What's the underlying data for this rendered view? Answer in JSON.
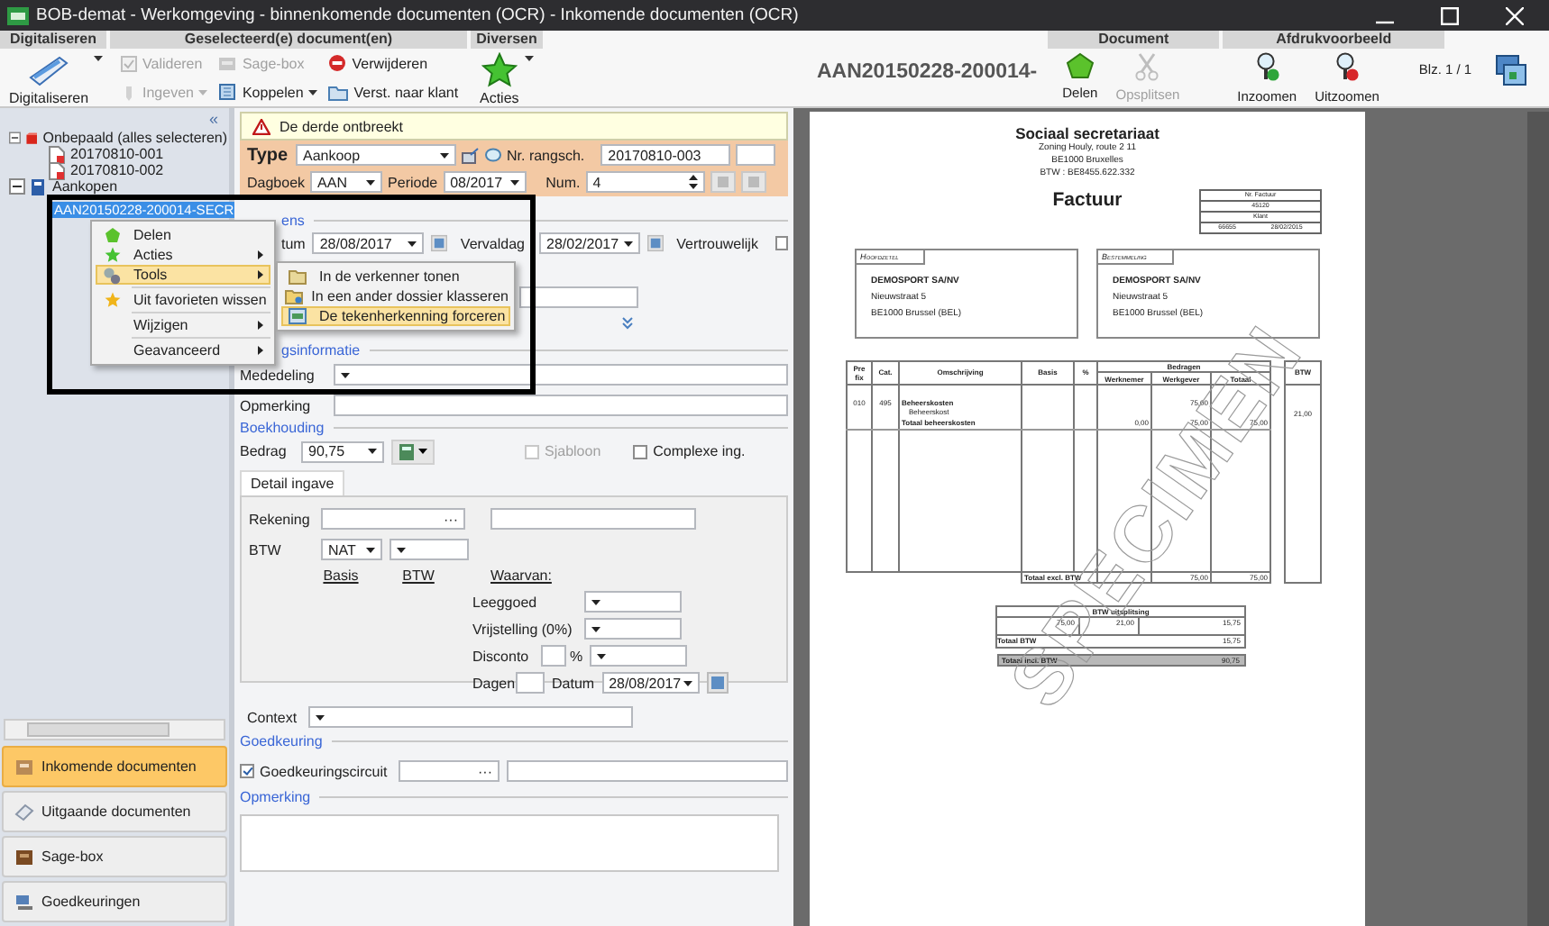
{
  "window": {
    "title": "BOB-demat - Werkomgeving - binnenkomende documenten (OCR) - Inkomende documenten (OCR)"
  },
  "ribbon": {
    "groups": [
      "Digitaliseren",
      "Geselecteerd(e) document(en)",
      "Diversen"
    ],
    "scan": {
      "label": "Digitaliseren",
      "disabled": false
    },
    "valideren": {
      "label": "Valideren",
      "disabled": true
    },
    "ingeven": {
      "label": "Ingeven",
      "disabled": true
    },
    "sagebox": {
      "label": "Sage-box",
      "disabled": true
    },
    "koppelen": {
      "label": "Koppelen",
      "disabled": false
    },
    "verwijderen": {
      "label": "Verwijderen",
      "disabled": false
    },
    "verst": {
      "label": "Verst. naar klant",
      "disabled": false
    },
    "acties": {
      "label": "Acties",
      "disabled": false
    }
  },
  "viewer_ribbon": {
    "doc_title": "AAN20150228-200014-",
    "groups": [
      "Document",
      "Afdrukvoorbeeld"
    ],
    "delen": {
      "label": "Delen",
      "disabled": false
    },
    "opsplitsen": {
      "label": "Opsplitsen",
      "disabled": true
    },
    "inzoomen": {
      "label": "Inzoomen",
      "disabled": false
    },
    "uitzoomen": {
      "label": "Uitzoomen",
      "disabled": false
    },
    "page": "Blz. 1 / 1"
  },
  "navigation": {
    "collapse": "«",
    "tree": [
      {
        "label": "Onbepaald (alles selecteren)",
        "expanded": true,
        "selected": false,
        "children": [
          {
            "label": "20170810-001",
            "selected": false
          },
          {
            "label": "20170810-002",
            "selected": false
          }
        ]
      },
      {
        "label": "Aankopen",
        "expanded": true,
        "selected": false,
        "children": [
          {
            "label": "AAN20150228-200014-SECR",
            "selected": true
          }
        ]
      }
    ],
    "modules": [
      {
        "label": "Inkomende documenten",
        "selected": true
      },
      {
        "label": "Uitgaande documenten",
        "selected": false
      },
      {
        "label": "Sage-box",
        "selected": false
      },
      {
        "label": "Goedkeuringen",
        "selected": false
      }
    ]
  },
  "context_menu": {
    "items": [
      {
        "kind": "item",
        "label": "Delen",
        "submenu": false,
        "selected": false
      },
      {
        "kind": "item",
        "label": "Acties",
        "submenu": true,
        "selected": false
      },
      {
        "kind": "item",
        "label": "Tools",
        "submenu": true,
        "selected": true,
        "children": [
          {
            "label": "In de verkenner tonen",
            "selected": false
          },
          {
            "label": "In een ander dossier klasseren",
            "selected": false
          },
          {
            "label": "De tekenherkenning forceren",
            "selected": true
          }
        ]
      },
      {
        "kind": "separator"
      },
      {
        "kind": "item",
        "label": "Uit favorieten wissen",
        "submenu": false,
        "selected": false
      },
      {
        "kind": "separator"
      },
      {
        "kind": "item",
        "label": "Wijzigen",
        "submenu": true,
        "selected": false
      },
      {
        "kind": "separator"
      },
      {
        "kind": "item",
        "label": "Geavanceerd",
        "submenu": true,
        "selected": false
      }
    ]
  },
  "form": {
    "alert": "De derde ontbreekt",
    "type": {
      "label": "Type",
      "value": "Aankoop"
    },
    "rangsch": {
      "label": "Nr. rangsch.",
      "value": "20170810-003"
    },
    "dagboek": {
      "label": "Dagboek",
      "value": "AAN"
    },
    "periode": {
      "label": "Periode",
      "value": "08/2017"
    },
    "num": {
      "label": "Num.",
      "value": "4"
    },
    "gegevens_heading": "ens",
    "datum": {
      "label": "tum",
      "value": "28/08/2017"
    },
    "vervaldag": {
      "label": "Vervaldag",
      "value": "28/02/2017"
    },
    "vertrouwelijk": {
      "label": "Vertrouwelijk",
      "checked": false
    },
    "betaling_heading": "gsinformatie",
    "mededeling": {
      "label": "Mededeling"
    },
    "opmerking": {
      "label": "Opmerking"
    },
    "boekhouding_heading": "Boekhouding",
    "bedrag": {
      "label": "Bedrag",
      "value": "90,75"
    },
    "sjabloon": {
      "label": "Sjabloon",
      "checked": false,
      "disabled": true
    },
    "complexe": {
      "label": "Complexe ing.",
      "checked": false,
      "disabled": false
    },
    "detail_tab": {
      "label": "Detail ingave",
      "selected": true
    },
    "rekening": {
      "label": "Rekening",
      "button": "···"
    },
    "btw": {
      "label": "BTW",
      "value": "NAT"
    },
    "basis_label": "Basis",
    "btw_label": "BTW",
    "waarvan": "Waarvan:",
    "leeggoed": {
      "label": "Leeggoed"
    },
    "vrijstelling": {
      "label": "Vrijstelling (0%)"
    },
    "disconto": {
      "label": "Disconto",
      "unit": "%"
    },
    "dagen": {
      "label": "Dagen"
    },
    "datum2": {
      "label": "Datum",
      "value": "28/08/2017"
    },
    "context": {
      "label": "Context"
    },
    "goedkeuring_heading": "Goedkeuring",
    "circuit": {
      "label": "Goedkeuringscircuit",
      "checked": true,
      "button": "···"
    },
    "opmerking_heading": "Opmerking"
  },
  "document": {
    "company": "Sociaal secretariaat",
    "address_lines": [
      "Zoning Houly, route 2 11",
      "BE1000 Bruxelles",
      "BTW : BE8455.622.332"
    ],
    "heading": "Factuur",
    "invoice_box": {
      "number_label": "Nr. Factuur",
      "number": "45120",
      "client_label": "Klant",
      "client": "66655",
      "date": "28/02/2015"
    },
    "parties": [
      {
        "caption": "Hoofdzetel",
        "name": "DEMOSPORT SA/NV",
        "street": "Nieuwstraat 5",
        "city": "BE1000 Brussel (BEL)"
      },
      {
        "caption": "Bestemmeling",
        "name": "DEMOSPORT SA/NV",
        "street": "Nieuwstraat 5",
        "city": "BE1000 Brussel (BEL)"
      }
    ],
    "lines": {
      "columns": [
        "Pre fix",
        "Cat.",
        "Omschrijving",
        "Basis",
        "%"
      ],
      "amounts_header": "Bedragen",
      "amount_columns": [
        "Werknemer",
        "Werkgever",
        "Totaal"
      ],
      "btw_header": "BTW",
      "group": {
        "prefix": "010",
        "cat": "495",
        "title": "Beheerskosten",
        "item": "Beheerskost",
        "werkgever": "75,00",
        "btw": "21,00"
      },
      "subtotal": {
        "label": "Totaal beheerskosten",
        "werknemer": "0,00",
        "werkgever": "75,00",
        "totaal": "75,00"
      },
      "total": {
        "label": "Totaal excl. BTW",
        "werkgever": "75,00",
        "totaal": "75,00"
      }
    },
    "vat": {
      "title": "BTW uitsplitsing",
      "base": "75,00",
      "rate": "21,00",
      "amount": "15,75",
      "total_label": "Totaal BTW",
      "total": "15,75"
    },
    "grand_total": {
      "label": "Totaal incl. BTW",
      "value": "90,75"
    },
    "stamp": "SPECIMEN"
  }
}
